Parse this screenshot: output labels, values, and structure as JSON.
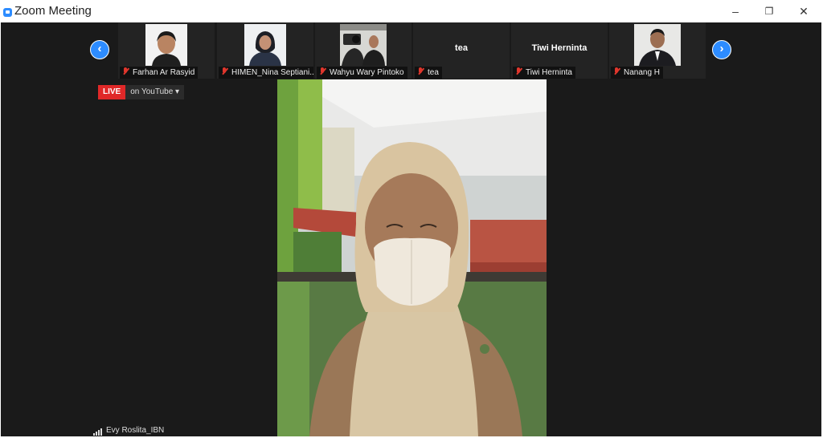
{
  "window": {
    "title": "Zoom Meeting",
    "minimize": "–",
    "maximize": "❐",
    "close": "✕"
  },
  "gallery": {
    "prev_icon": "‹",
    "next_icon": "›",
    "tiles": [
      {
        "name": "Farhan Ar Rasyid",
        "video": true
      },
      {
        "name": "HIMEN_Nina Septiani...",
        "video": true
      },
      {
        "name": "Wahyu Wary Pintoko",
        "video": true
      },
      {
        "name": "tea",
        "display_text": "tea",
        "video": false
      },
      {
        "name": "Tiwi Herninta",
        "display_text": "Tiwi Herninta",
        "video": false
      },
      {
        "name": "Nanang H",
        "video": true
      }
    ]
  },
  "live": {
    "badge": "LIVE",
    "stream": "on YouTube ▾"
  },
  "active_speaker": {
    "name": "Evy Roslita_IBN"
  },
  "colors": {
    "accent": "#2d8cff",
    "live_red": "#e02828",
    "muted_red": "#e0362c"
  }
}
